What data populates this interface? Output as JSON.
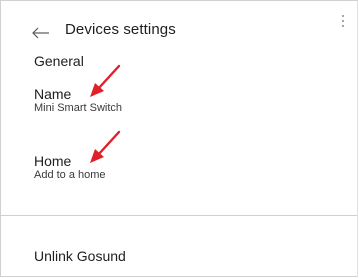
{
  "header": {
    "back_icon": "back-arrow-icon",
    "title": "Devices settings",
    "more_icon": "more-vertical-icon"
  },
  "general": {
    "section_title": "General",
    "name": {
      "label": "Name",
      "value": "Mini Smart Switch"
    },
    "home": {
      "label": "Home",
      "value": "Add to a home"
    }
  },
  "unlink": {
    "label": "Unlink Gosund"
  },
  "annotations": {
    "arrow_icon": "red-pointer-arrow-icon",
    "arrow_color": "#e0202a"
  },
  "colors": {
    "text": "#202020",
    "divider": "#cfcfcf",
    "background": "#ffffff"
  }
}
